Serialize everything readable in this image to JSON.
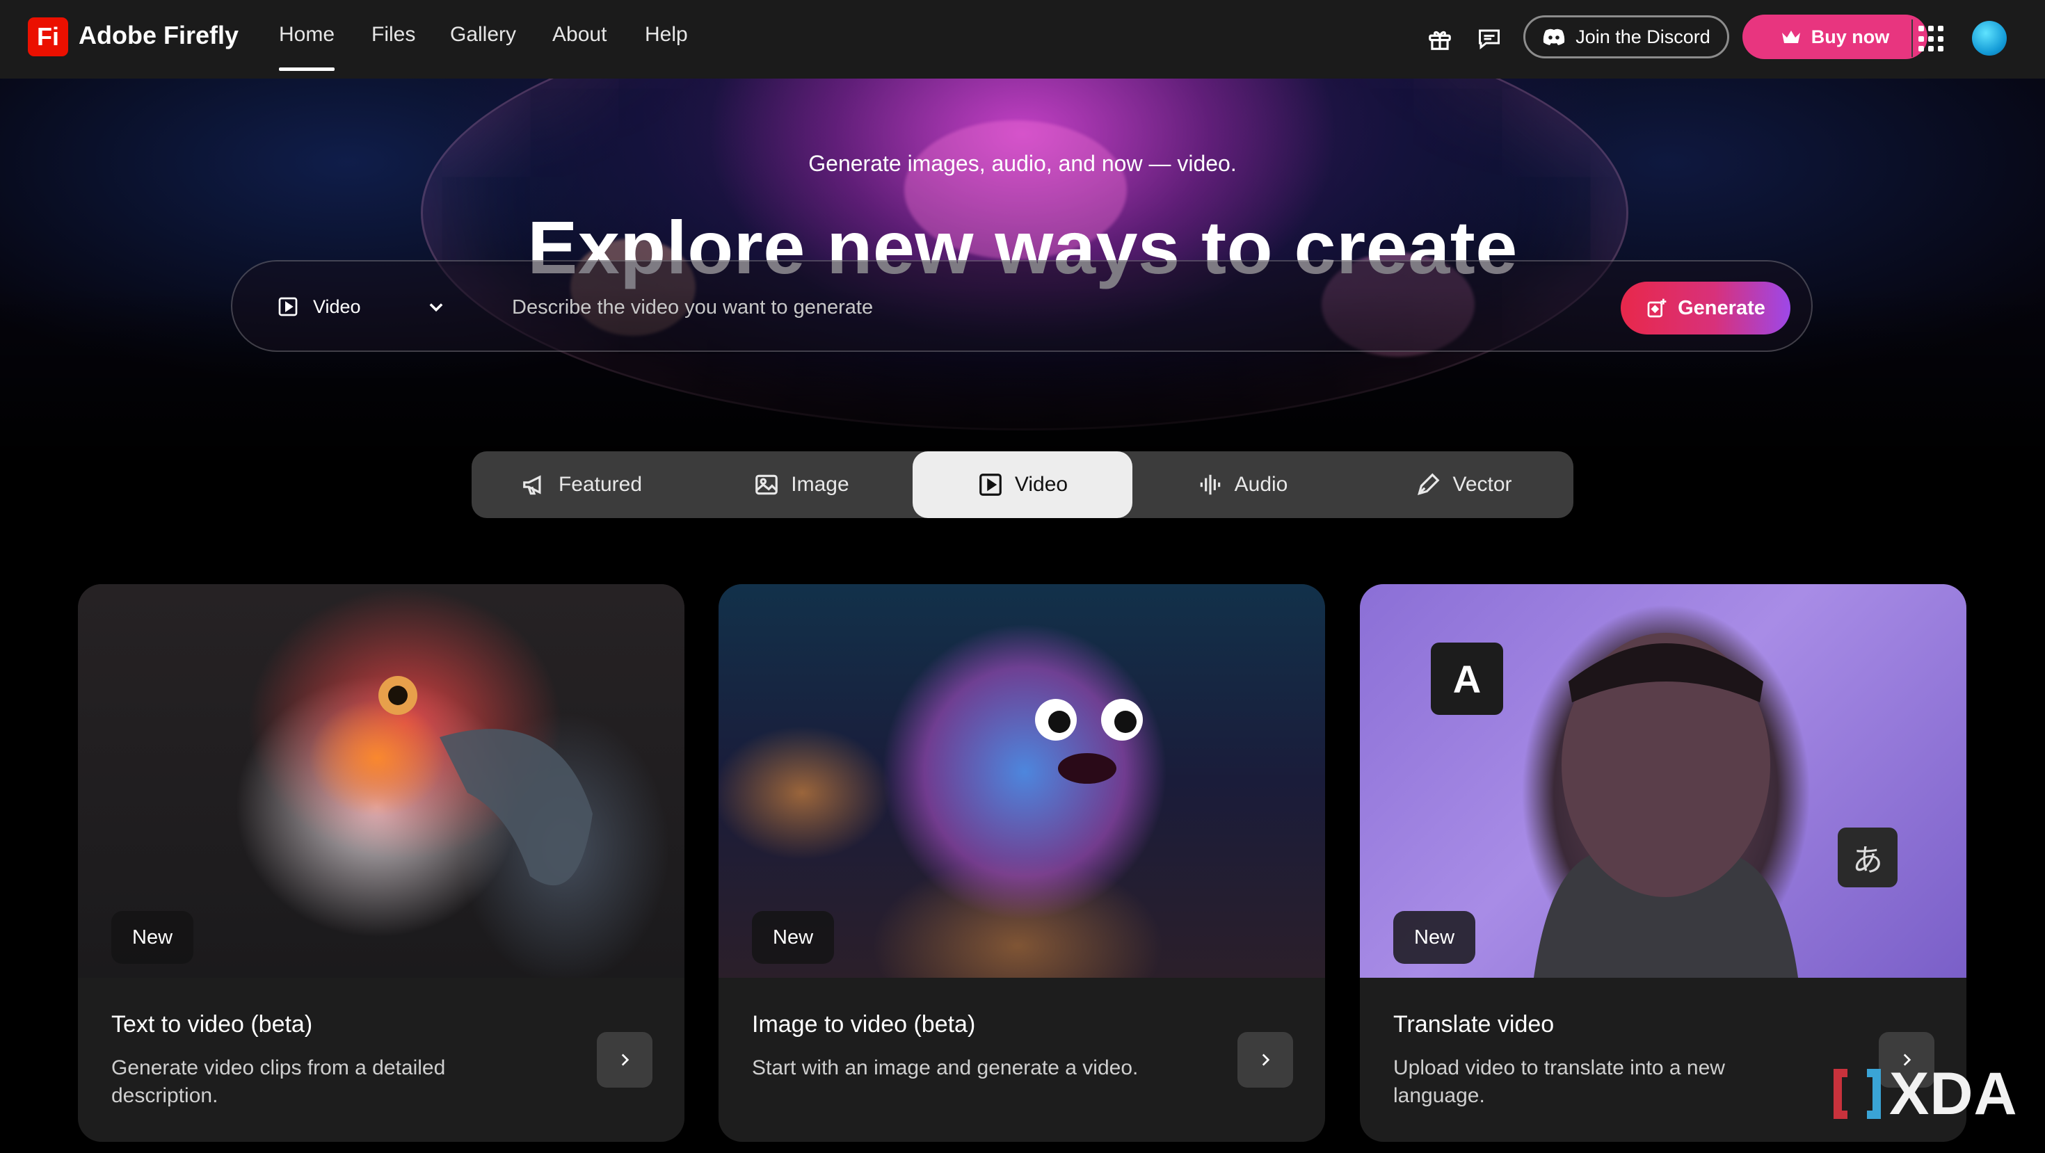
{
  "app": {
    "logo_text": "Fi",
    "name": "Adobe Firefly"
  },
  "nav": {
    "links": [
      "Home",
      "Files",
      "Gallery",
      "About",
      "Help"
    ],
    "active": "Home",
    "gift_icon": "gift-icon",
    "chat_icon": "chat-bubble-icon",
    "discord_label": "Join the Discord",
    "buy_label": "Buy now"
  },
  "hero": {
    "subtitle": "Generate images, audio, and now — video.",
    "title": "Explore new ways to create"
  },
  "prompt": {
    "type_selected": "Video",
    "placeholder": "Describe the video you want to generate",
    "generate_label": "Generate"
  },
  "tabs": {
    "items": [
      "Featured",
      "Image",
      "Video",
      "Audio",
      "Vector"
    ],
    "active": "Video"
  },
  "cards": [
    {
      "badge": "New",
      "title": "Text to video (beta)",
      "description": "Generate video clips from a detailed description."
    },
    {
      "badge": "New",
      "title": "Image to video (beta)",
      "description": "Start with an image and generate a video."
    },
    {
      "badge": "New",
      "title": "Translate video",
      "description": "Upload video to translate into a new language.",
      "overlay_letter": "A",
      "overlay_kana": "あ"
    }
  ],
  "watermark": {
    "text": "XDA"
  },
  "colors": {
    "brand_red": "#eb1000",
    "buy_pink": "#e8357f",
    "generate_gradient_start": "#e8284b",
    "generate_gradient_end": "#9d48e8",
    "nav_bg": "#1b1b1b"
  }
}
